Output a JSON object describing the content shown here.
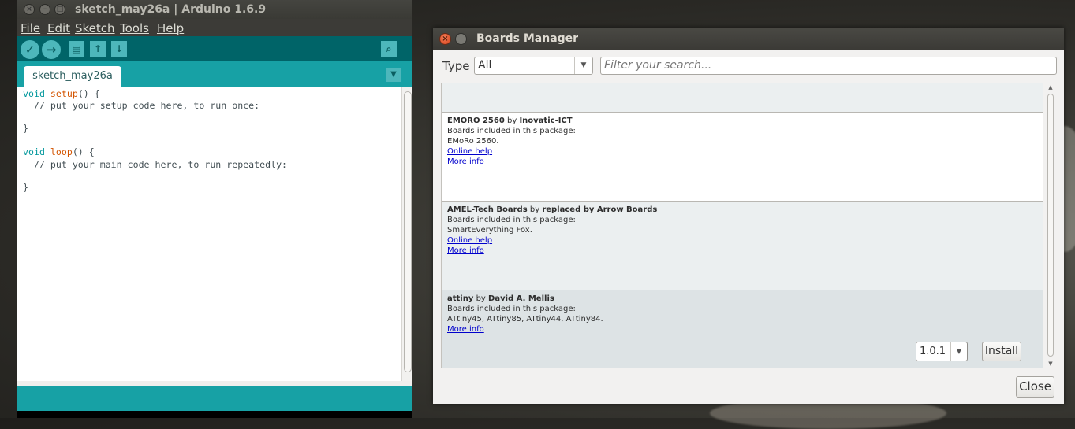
{
  "ide": {
    "title": "sketch_may26a | Arduino 1.6.9",
    "menu": [
      "File",
      "Edit",
      "Sketch",
      "Tools",
      "Help"
    ],
    "tab_label": "sketch_may26a",
    "toolbar_icons": [
      "verify-icon",
      "upload-icon",
      "new-icon",
      "open-icon",
      "save-icon",
      "serial-monitor-icon"
    ],
    "code": {
      "l1_kw": "void",
      "l1_fn": "setup",
      "l1_rest": "() {",
      "l2": "  // put your setup code here, to run once:",
      "l4": "}",
      "l6_kw": "void",
      "l6_fn": "loop",
      "l6_rest": "() {",
      "l7": "  // put your main code here, to run repeatedly:",
      "l9": "}"
    },
    "colors": {
      "toolbar": "#006468",
      "tabbar": "#17a1a5",
      "keyword": "#00979c"
    }
  },
  "boards_manager": {
    "title": "Boards Manager",
    "type_label": "Type",
    "type_value": "All",
    "search_placeholder": "Filter your search...",
    "boards": [
      {
        "name": "EMORO 2560",
        "by": "by",
        "author": "Inovatic-ICT",
        "included_label": "Boards included in this package:",
        "boards_list": "EMoRo 2560.",
        "online_help": "Online help",
        "more_info": "More info"
      },
      {
        "name": "AMEL-Tech Boards",
        "by": "by",
        "author": "replaced by Arrow Boards",
        "included_label": "Boards included in this package:",
        "boards_list": "SmartEverything Fox.",
        "online_help": "Online help",
        "more_info": "More info"
      },
      {
        "name": "attiny",
        "by": "by",
        "author": "David A. Mellis",
        "included_label": "Boards included in this package:",
        "boards_list": "ATtiny45, ATtiny85, ATtiny44, ATtiny84.",
        "more_info": "More info",
        "version": "1.0.1",
        "install_label": "Install"
      }
    ],
    "close_label": "Close"
  }
}
